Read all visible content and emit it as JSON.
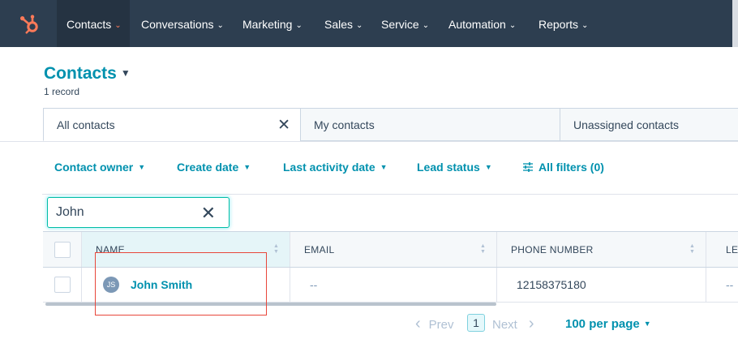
{
  "nav": {
    "items": [
      {
        "label": "Contacts",
        "active": true
      },
      {
        "label": "Conversations"
      },
      {
        "label": "Marketing"
      },
      {
        "label": "Sales"
      },
      {
        "label": "Service"
      },
      {
        "label": "Automation"
      },
      {
        "label": "Reports"
      }
    ],
    "chevron": "⌄",
    "logo_icon": "hubspot-sprocket-icon",
    "brand_color": "#ff7a59",
    "bg_color": "#2d3e50"
  },
  "header": {
    "title": "Contacts",
    "record_count": "1 record"
  },
  "view_tabs": [
    {
      "label": "All contacts",
      "active": true,
      "close": "✕"
    },
    {
      "label": "My contacts"
    },
    {
      "label": "Unassigned contacts"
    }
  ],
  "filters": [
    {
      "label": "Contact owner"
    },
    {
      "label": "Create date"
    },
    {
      "label": "Last activity date"
    },
    {
      "label": "Lead status"
    },
    {
      "label": "All filters (0)",
      "icon": "sliders-icon"
    }
  ],
  "search": {
    "value": "John",
    "clear": "✕"
  },
  "table": {
    "columns": [
      "NAME",
      "EMAIL",
      "PHONE NUMBER",
      "LE"
    ],
    "rows": [
      {
        "initials": "JS",
        "name": "John Smith",
        "email": "--",
        "phone": "12158375180",
        "lead": "--"
      }
    ]
  },
  "pagination": {
    "prev": "Prev",
    "page": "1",
    "next": "Next",
    "per_page": "100 per page"
  },
  "colors": {
    "link": "#0091ae",
    "text": "#33475b",
    "highlight": "#e8473b"
  }
}
